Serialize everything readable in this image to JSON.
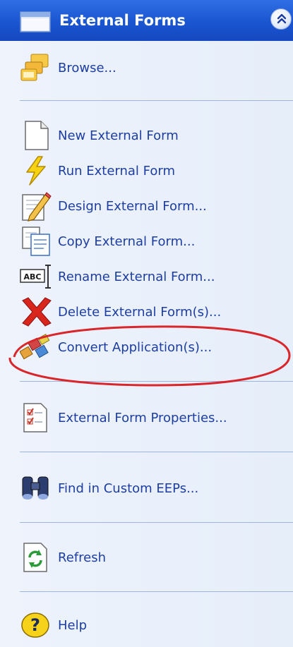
{
  "header": {
    "title": "External Forms",
    "title_color": "#ffffff",
    "bar_color": "#1a55d0",
    "collapse_icon": "double-chevron-up-icon"
  },
  "panel_background": "#e6eefa",
  "link_color": "#1d3ea0",
  "separator_color": "#9db3e0",
  "items": [
    {
      "label": "Browse...",
      "icon": "folder-browse-icon"
    },
    {
      "label": "New External Form",
      "icon": "new-document-icon"
    },
    {
      "label": "Run External Form",
      "icon": "lightning-icon"
    },
    {
      "label": "Design External Form...",
      "icon": "pencil-edit-icon"
    },
    {
      "label": "Copy External Form...",
      "icon": "copy-document-icon"
    },
    {
      "label": "Rename External Form...",
      "icon": "rename-abc-icon"
    },
    {
      "label": "Delete External Form(s)...",
      "icon": "delete-x-icon"
    },
    {
      "label": "Convert Application(s)...",
      "icon": "convert-app-icon"
    },
    {
      "label": "External Form Properties...",
      "icon": "properties-checklist-icon"
    },
    {
      "label": "Find in Custom EEPs...",
      "icon": "binoculars-icon"
    },
    {
      "label": "Refresh",
      "icon": "refresh-icon"
    },
    {
      "label": "Help",
      "icon": "help-icon"
    }
  ],
  "annotation": {
    "shape": "ellipse",
    "color": "#d9262b"
  }
}
